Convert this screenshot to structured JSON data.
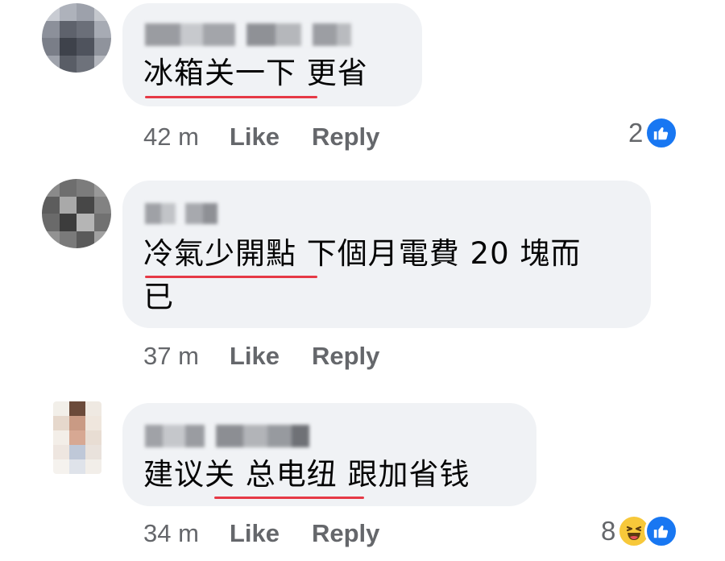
{
  "comments": [
    {
      "author": "Hong Man Ng",
      "text_underlined": "冰箱关一下",
      "text_rest": " 更省",
      "time": "42 m",
      "like_label": "Like",
      "reply_label": "Reply",
      "reaction_count": "2",
      "reactions": [
        "like-icon"
      ]
    },
    {
      "author": "",
      "text_underlined": "冷氣少開點",
      "text_rest": " 下個月電費 20 塊而",
      "text_line2": "已",
      "time": "37 m",
      "like_label": "Like",
      "reply_label": "Reply"
    },
    {
      "author": "King Leung",
      "text_first": "建议",
      "text_underlined": "关 总电纽",
      "text_rest": " 跟加省钱",
      "time": "34 m",
      "like_label": "Like",
      "reply_label": "Reply",
      "reaction_count": "8",
      "reactions": [
        "haha-icon",
        "like-icon"
      ]
    }
  ],
  "colors": {
    "bubble": "#f0f2f5",
    "meta_text": "#65676b",
    "like_blue": "#1877f2",
    "haha_yellow": "#f7c83a",
    "underline_red": "#e63946"
  }
}
